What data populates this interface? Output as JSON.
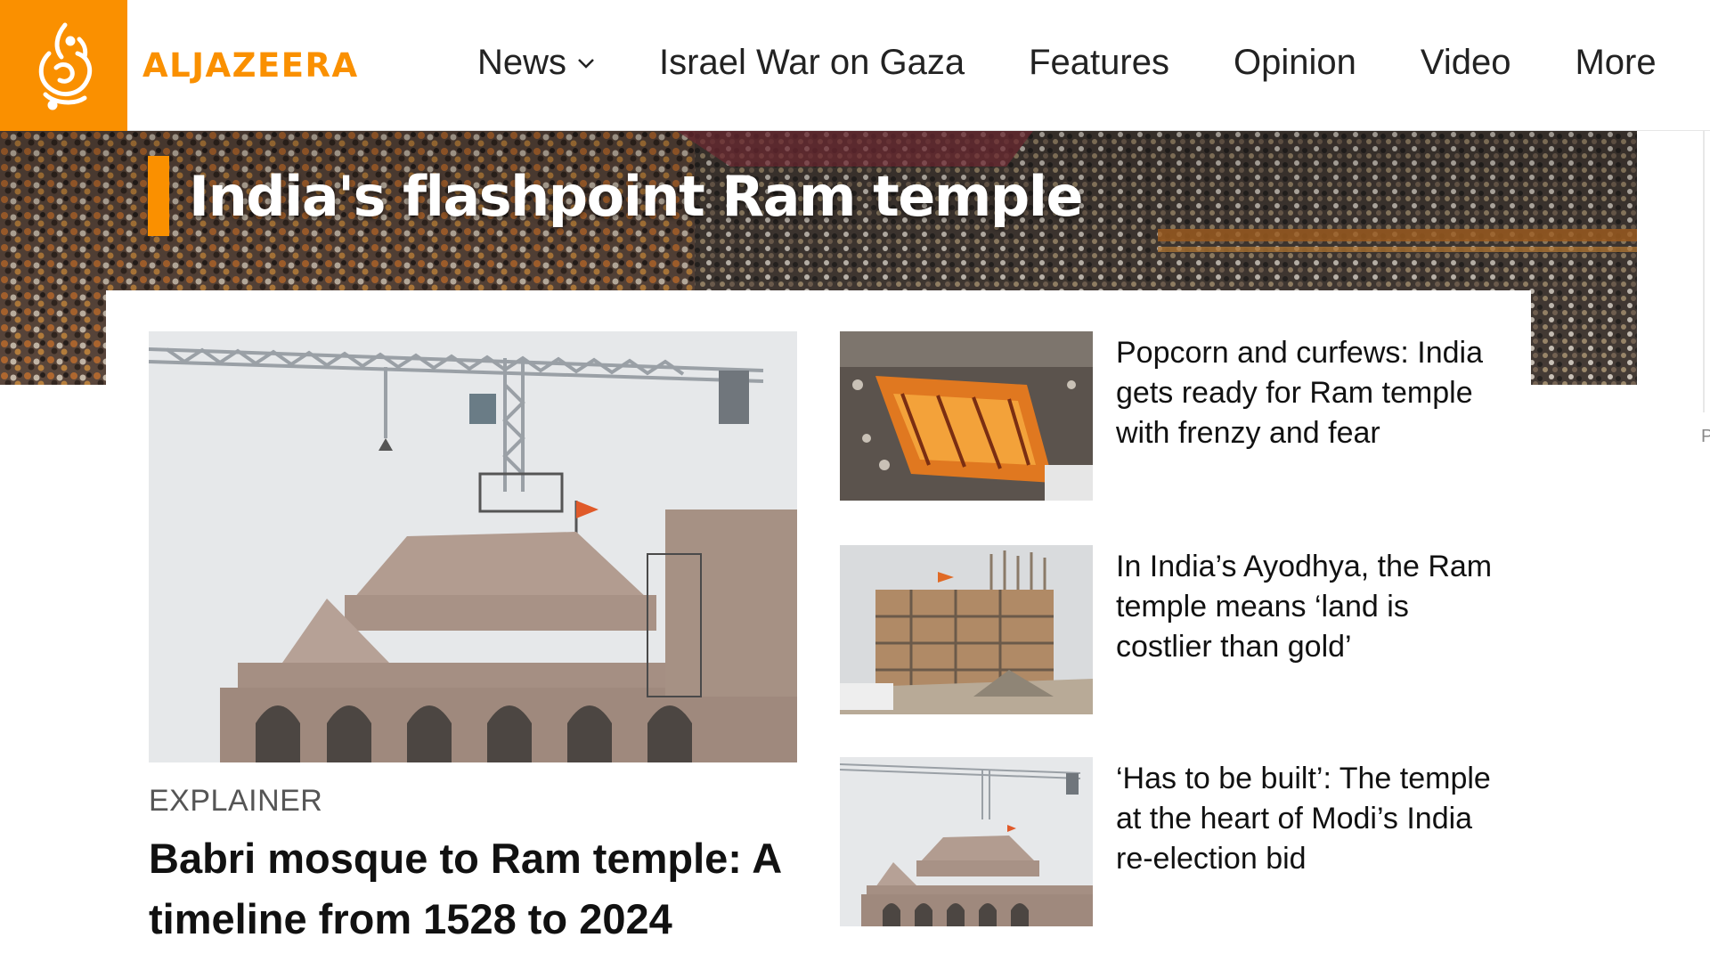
{
  "brand": {
    "name": "ALJAZEERA",
    "accent": "#fa9000"
  },
  "nav": {
    "items": [
      {
        "label": "News",
        "has_dropdown": true
      },
      {
        "label": "Israel War on Gaza"
      },
      {
        "label": "Features"
      },
      {
        "label": "Opinion"
      },
      {
        "label": "Video"
      },
      {
        "label": "More"
      }
    ]
  },
  "hero": {
    "title": "India's flashpoint Ram temple"
  },
  "feature": {
    "kicker": "EXPLAINER",
    "title": "Babri mosque to Ram temple: A timeline from 1528 to 2024"
  },
  "side_stories": [
    {
      "title": "Popcorn and curfews: India gets ready for Ram temple with frenzy and fear",
      "thumb": "crowd-float-photo"
    },
    {
      "title": "In India’s Ayodhya, the Ram temple means ‘land is costlier than gold’",
      "thumb": "construction-photo"
    },
    {
      "title": "‘Has to be built’: The temple at the heart of Modi’s India re-election bid",
      "thumb": "temple-crane-photo"
    }
  ],
  "ad": {
    "label": "P"
  }
}
